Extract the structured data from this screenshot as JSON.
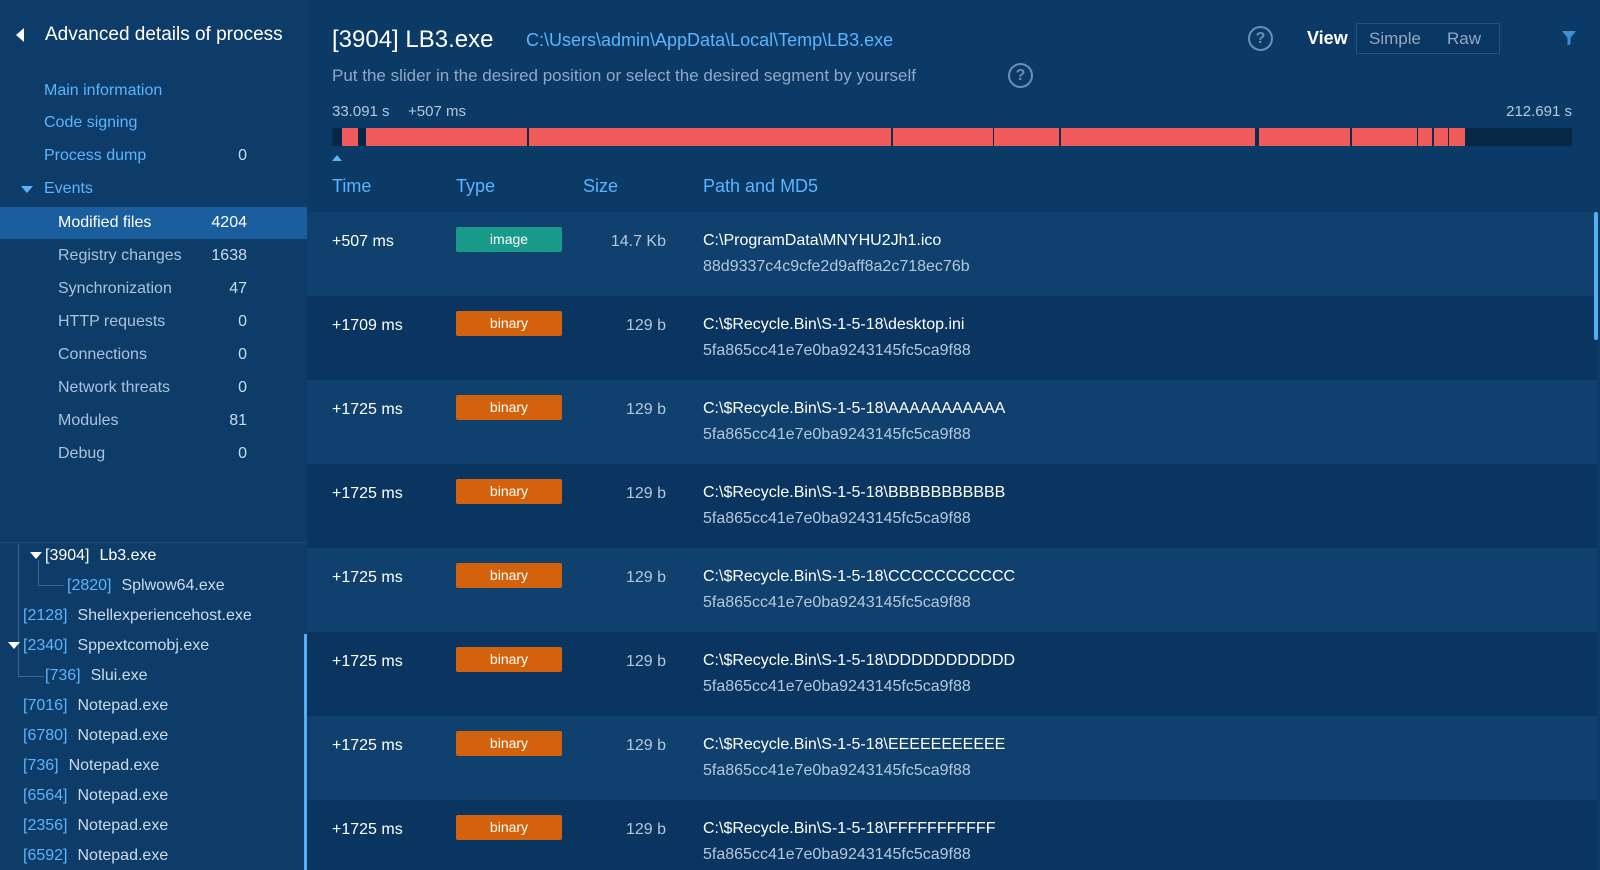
{
  "sidebar": {
    "title": "Advanced details of process",
    "nav": [
      {
        "label": "Main information",
        "count": ""
      },
      {
        "label": "Code signing",
        "count": ""
      },
      {
        "label": "Process dump",
        "count": "0"
      },
      {
        "label": "Events",
        "count": ""
      }
    ],
    "events": [
      {
        "label": "Modified files",
        "count": "4204"
      },
      {
        "label": "Registry changes",
        "count": "1638"
      },
      {
        "label": "Synchronization",
        "count": "47"
      },
      {
        "label": "HTTP requests",
        "count": "0"
      },
      {
        "label": "Connections",
        "count": "0"
      },
      {
        "label": "Network threats",
        "count": "0"
      },
      {
        "label": "Modules",
        "count": "81"
      },
      {
        "label": "Debug",
        "count": "0"
      }
    ],
    "tree": [
      {
        "pid": "[3904]",
        "name": "Lb3.exe"
      },
      {
        "pid": "[2820]",
        "name": "Splwow64.exe"
      },
      {
        "pid": "[2128]",
        "name": "Shellexperiencehost.exe"
      },
      {
        "pid": "[2340]",
        "name": "Sppextcomobj.exe"
      },
      {
        "pid": "[736]",
        "name": "Slui.exe"
      },
      {
        "pid": "[7016]",
        "name": "Notepad.exe"
      },
      {
        "pid": "[6780]",
        "name": "Notepad.exe"
      },
      {
        "pid": "[736]",
        "name": "Notepad.exe"
      },
      {
        "pid": "[6564]",
        "name": "Notepad.exe"
      },
      {
        "pid": "[2356]",
        "name": "Notepad.exe"
      },
      {
        "pid": "[6592]",
        "name": "Notepad.exe"
      }
    ]
  },
  "header": {
    "title": "[3904] LB3.exe",
    "path": "C:\\Users\\admin\\AppData\\Local\\Temp\\LB3.exe",
    "help": "?",
    "view_label": "View",
    "view_simple": "Simple",
    "view_raw": "Raw",
    "instruction": "Put the slider in the desired position or select the desired segment by yourself"
  },
  "timeline": {
    "start": "33.091 s",
    "offset": "+507 ms",
    "end": "212.691 s"
  },
  "table": {
    "columns": {
      "time": "Time",
      "type": "Type",
      "size": "Size",
      "path": "Path and MD5"
    },
    "rows": [
      {
        "time": "+507 ms",
        "type": "image",
        "size": "14.7 Kb",
        "path": "C:\\ProgramData\\MNYHU2Jh1.ico",
        "md5": "88d9337c4c9cfe2d9aff8a2c718ec76b"
      },
      {
        "time": "+1709 ms",
        "type": "binary",
        "size": "129 b",
        "path": "C:\\$Recycle.Bin\\S-1-5-18\\desktop.ini",
        "md5": "5fa865cc41e7e0ba9243145fc5ca9f88"
      },
      {
        "time": "+1725 ms",
        "type": "binary",
        "size": "129 b",
        "path": "C:\\$Recycle.Bin\\S-1-5-18\\AAAAAAAAAAA",
        "md5": "5fa865cc41e7e0ba9243145fc5ca9f88"
      },
      {
        "time": "+1725 ms",
        "type": "binary",
        "size": "129 b",
        "path": "C:\\$Recycle.Bin\\S-1-5-18\\BBBBBBBBBBB",
        "md5": "5fa865cc41e7e0ba9243145fc5ca9f88"
      },
      {
        "time": "+1725 ms",
        "type": "binary",
        "size": "129 b",
        "path": "C:\\$Recycle.Bin\\S-1-5-18\\CCCCCCCCCCC",
        "md5": "5fa865cc41e7e0ba9243145fc5ca9f88"
      },
      {
        "time": "+1725 ms",
        "type": "binary",
        "size": "129 b",
        "path": "C:\\$Recycle.Bin\\S-1-5-18\\DDDDDDDDDDD",
        "md5": "5fa865cc41e7e0ba9243145fc5ca9f88"
      },
      {
        "time": "+1725 ms",
        "type": "binary",
        "size": "129 b",
        "path": "C:\\$Recycle.Bin\\S-1-5-18\\EEEEEEEEEEE",
        "md5": "5fa865cc41e7e0ba9243145fc5ca9f88"
      },
      {
        "time": "+1725 ms",
        "type": "binary",
        "size": "129 b",
        "path": "C:\\$Recycle.Bin\\S-1-5-18\\FFFFFFFFFFF",
        "md5": "5fa865cc41e7e0ba9243145fc5ca9f88"
      }
    ]
  },
  "colors": {
    "background": "#0c3a66",
    "accent": "#5ab4ff",
    "active_nav": "#1a5e9e",
    "image_badge": "#1a9a8a",
    "binary_badge": "#d4620c",
    "timeline_fill": "#f05a5a"
  },
  "icons": [
    "back-arrow-icon",
    "help-icon",
    "filter-icon",
    "caret-down-icon"
  ]
}
